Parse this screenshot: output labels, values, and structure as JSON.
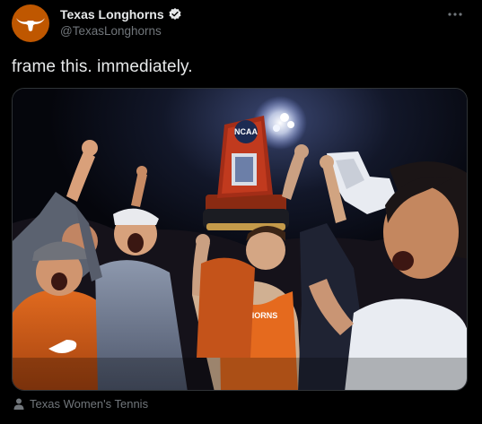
{
  "account": {
    "display_name": "Texas Longhorns",
    "handle": "@TexasLonghorns",
    "avatar_icon": "longhorn-logo-icon",
    "verified_icon": "verified-badge-icon",
    "brand_color": "#bf5700"
  },
  "tweet": {
    "text": "frame this. immediately."
  },
  "media": {
    "trophy_text": "NCAA",
    "jersey_text": "LONGHORNS"
  },
  "caption": {
    "icon": "person-icon",
    "text": "Texas Women's Tennis"
  },
  "menu": {
    "icon": "more-options-icon"
  }
}
